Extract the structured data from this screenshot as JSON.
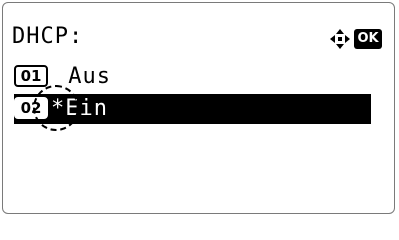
{
  "screen": {
    "title": "DHCP:"
  },
  "nav": {
    "arrows_icon": "four-way-arrows-icon",
    "ok_label": "OK"
  },
  "options": [
    {
      "number": "01",
      "label": " Aus",
      "selected": false
    },
    {
      "number": "02",
      "label": "*Ein",
      "selected": true
    }
  ]
}
